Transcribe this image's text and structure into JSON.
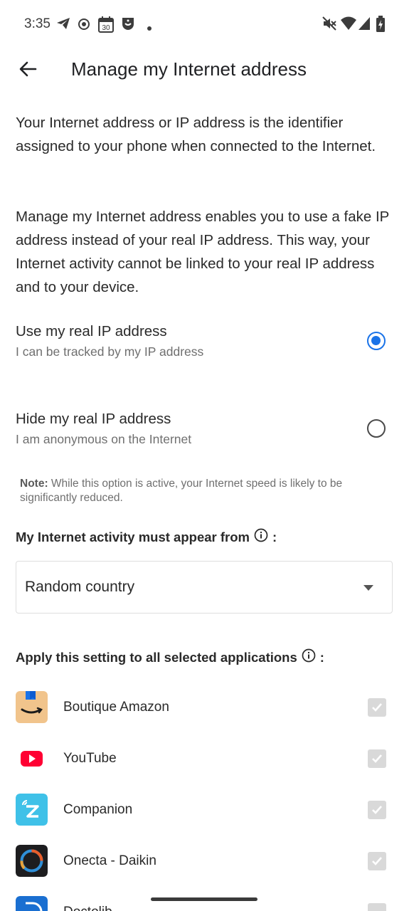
{
  "status_bar": {
    "time": "3:35",
    "icons_left": [
      "telegram-icon",
      "record-icon",
      "calendar-icon",
      "shield-face-icon",
      "dot-icon"
    ],
    "calendar_day": "30",
    "icons_right": [
      "mute-icon",
      "wifi-icon",
      "signal-icon",
      "battery-icon"
    ]
  },
  "header": {
    "back_icon": "arrow-left-icon",
    "title": "Manage my Internet address"
  },
  "intro": {
    "paragraph_1": "Your Internet address or IP address is the identifier assigned to your phone when connected to the Internet.",
    "paragraph_2": "Manage my Internet address enables you to use a fake IP address instead of your real IP address. This way, your Internet activity cannot be linked to your real IP address and to your device."
  },
  "options": [
    {
      "title": "Use my real IP address",
      "subtitle": "I can be tracked by my IP address",
      "selected": true
    },
    {
      "title": "Hide my real IP address",
      "subtitle": "I am anonymous on the Internet",
      "selected": false
    }
  ],
  "note": {
    "label": "Note:",
    "text": " While this option is active, your Internet speed is likely to be significantly reduced."
  },
  "location": {
    "label": "My Internet activity must appear from",
    "suffix": ":",
    "selected": "Random country"
  },
  "apps_section": {
    "label": "Apply this setting to all selected applications",
    "suffix": ":",
    "apps": [
      {
        "name": "Boutique Amazon",
        "icon": "amazon-icon",
        "checked": true
      },
      {
        "name": "YouTube",
        "icon": "youtube-icon",
        "checked": true
      },
      {
        "name": "Companion",
        "icon": "companion-icon",
        "checked": true
      },
      {
        "name": "Onecta - Daikin",
        "icon": "onecta-icon",
        "checked": true
      },
      {
        "name": "Doctolib",
        "icon": "doctolib-icon",
        "checked": true
      }
    ]
  },
  "colors": {
    "accent": "#1a73e8",
    "text": "#2a2a2a",
    "secondary_text": "#6f6f6f",
    "disabled_checkbox": "#d9d9d9"
  }
}
